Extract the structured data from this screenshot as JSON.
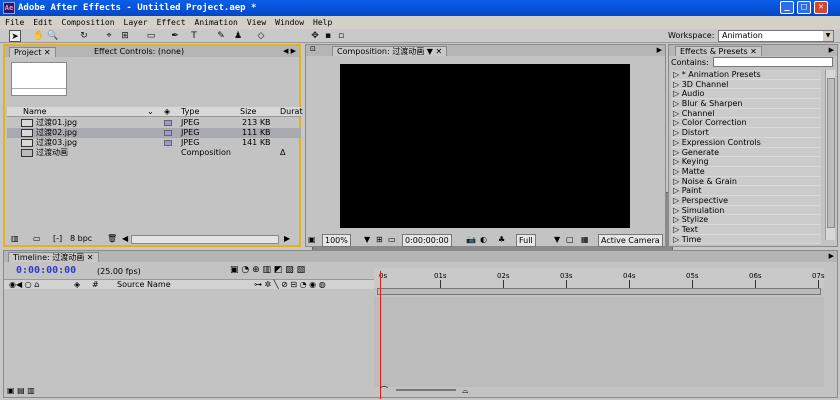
{
  "window": {
    "title": "Adobe After Effects - Untitled Project.aep *",
    "app_icon": "Ae"
  },
  "menu": [
    "File",
    "Edit",
    "Composition",
    "Layer",
    "Effect",
    "Animation",
    "View",
    "Window",
    "Help"
  ],
  "workspace": {
    "label": "Workspace:",
    "value": "Animation"
  },
  "project_panel": {
    "tabs": [
      "Project",
      "Effect Controls: (none)"
    ],
    "columns": {
      "name": "Name",
      "type": "Type",
      "size": "Size",
      "duration": "Durat"
    },
    "items": [
      {
        "name": "过渡01.jpg",
        "type": "JPEG",
        "size": "213 KB",
        "duration": ""
      },
      {
        "name": "过渡02.jpg",
        "type": "JPEG",
        "size": "111 KB",
        "duration": ""
      },
      {
        "name": "过渡03.jpg",
        "type": "JPEG",
        "size": "141 KB",
        "duration": ""
      },
      {
        "name": "过渡动画",
        "type": "Composition",
        "size": "",
        "duration": "Δ"
      }
    ],
    "bpc": "8 bpc"
  },
  "composition_panel": {
    "tab": "Composition: 过渡动画",
    "zoom": "100%",
    "timecode": "0:00:00:00",
    "resolution": "Full",
    "camera": "Active Camera"
  },
  "effects_panel": {
    "tab": "Effects & Presets",
    "contains_label": "Contains:",
    "items": [
      "* Animation Presets",
      "3D Channel",
      "Audio",
      "Blur & Sharpen",
      "Channel",
      "Color Correction",
      "Distort",
      "Expression Controls",
      "Generate",
      "Keying",
      "Matte",
      "Noise & Grain",
      "Paint",
      "Perspective",
      "Simulation",
      "Stylize",
      "Text",
      "Time"
    ]
  },
  "timeline_panel": {
    "tab": "Timeline: 过渡动画",
    "timecode": "0:00:00:00",
    "fps": "(25.00 fps)",
    "source_name": "Source Name",
    "ruler": [
      "0s",
      "01s",
      "02s",
      "03s",
      "04s",
      "05s",
      "06s",
      "07s"
    ]
  }
}
